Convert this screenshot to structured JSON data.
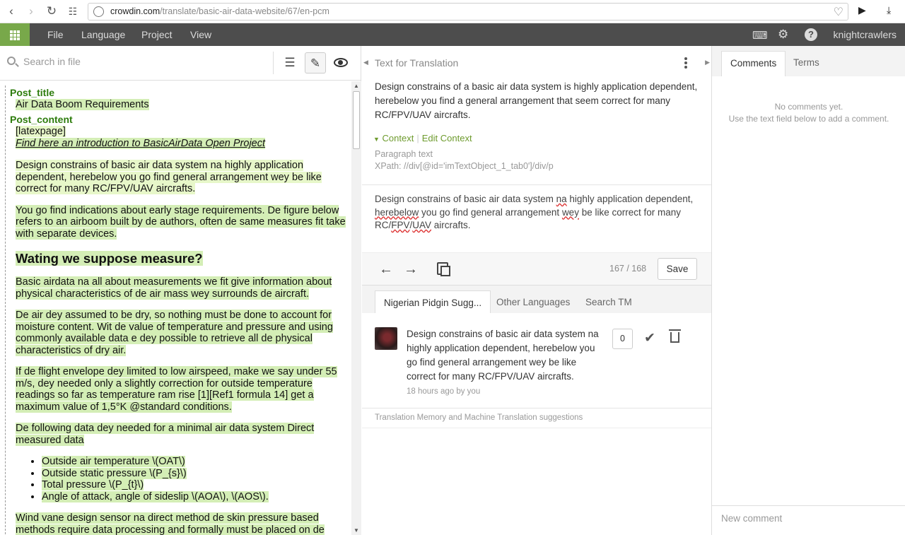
{
  "browser": {
    "url_domain": "crowdin.com",
    "url_path": "/translate/basic-air-data-website/67/en-pcm"
  },
  "appbar": {
    "menu": [
      "File",
      "Language",
      "Project",
      "View"
    ],
    "username": "knightcrawlers"
  },
  "left": {
    "search_placeholder": "Search in file",
    "doc": {
      "post_title_label": "Post_title",
      "post_title": "Air Data Boom Requirements",
      "post_content_label": "Post_content",
      "latexpage": "[latexpage]",
      "intro_link": "Find here an introduction to BasicAirData Open Project",
      "p1": "Design constrains of basic air data system na highly application dependent, herebelow you go find general arrangement wey be like correct for many RC/FPV/UAV aircrafts.",
      "p2": "You go find indications about early stage requirements. De figure below refers to an airboom built by de authors, often de same measures fit take with separate devices.",
      "heading": "Wating we suppose measure?",
      "p3": "Basic airdata na all about measurements we fit give information about physical characteristics of de air mass wey surrounds de aircraft.",
      "p4": "De air dey assumed to be dry, so nothing must be done to account for moisture content. Wit de value of temperature and pressure and using commonly available data e dey possible to retrieve all de physical characteristics of dry air.",
      "p5": "If de flight envelope dey limited to low airspeed, make we say under 55 m/s, dey needed only a slightly correction for outside temperature readings so far as temperature ram rise [1][Ref1 formula 14] get a maximum value of 1,5°K @standard conditions.",
      "p6": "De following data dey needed for a minimal air data system Direct measured data",
      "list": [
        "Outside air temperature \\(OAT\\)",
        "Outside static pressure \\(P_{s}\\)",
        "Total pressure \\(P_{t}\\)",
        "Angle of attack, angle of sideslip \\(AOA\\), \\(AOS\\)."
      ],
      "p7": "Wind vane design sensor na direct method de skin pressure based methods require data processing and formally must be placed on de"
    }
  },
  "middle": {
    "title": "Text for Translation",
    "source": "Design constrains of a basic air data system is highly application dependent, herebelow you find a general arrangement that seem correct for many RC/FPV/UAV aircrafts.",
    "context_label": "Context",
    "edit_context_label": "Edit Context",
    "paragraph_text": "Paragraph text",
    "xpath": "XPath: //div[@id='imTextObject_1_tab0']/div/p",
    "translation": {
      "t1": "Design constrains of basic air data system ",
      "t2": "na",
      "t3": " highly application dependent, ",
      "t4": "herebelow",
      "t5": " you go find general arrangement ",
      "t6": "wey",
      "t7": " be like correct for many RC/",
      "t8": "FPV",
      "t9": "/",
      "t10": "UAV",
      "t11": " aircrafts."
    },
    "counter": "167 / 168",
    "save_label": "Save",
    "tabs": [
      "Nigerian Pidgin Sugg...",
      "Other Languages",
      "Search TM"
    ],
    "suggestion": {
      "text": "Design constrains of basic air data system na highly application dependent, herebelow you go find general arrangement wey be like correct for many RC/FPV/UAV aircrafts.",
      "meta": "18 hours ago by you",
      "votes": "0"
    },
    "tm_label": "Translation Memory and Machine Translation suggestions"
  },
  "right": {
    "tabs": [
      "Comments",
      "Terms"
    ],
    "no_comments_1": "No comments yet.",
    "no_comments_2": "Use the text field below to add a comment.",
    "new_comment_placeholder": "New comment"
  },
  "colors": {
    "accent_green": "#78a84a",
    "appbar_bg": "#4d4d4d",
    "highlight": "#d4eeb6"
  }
}
